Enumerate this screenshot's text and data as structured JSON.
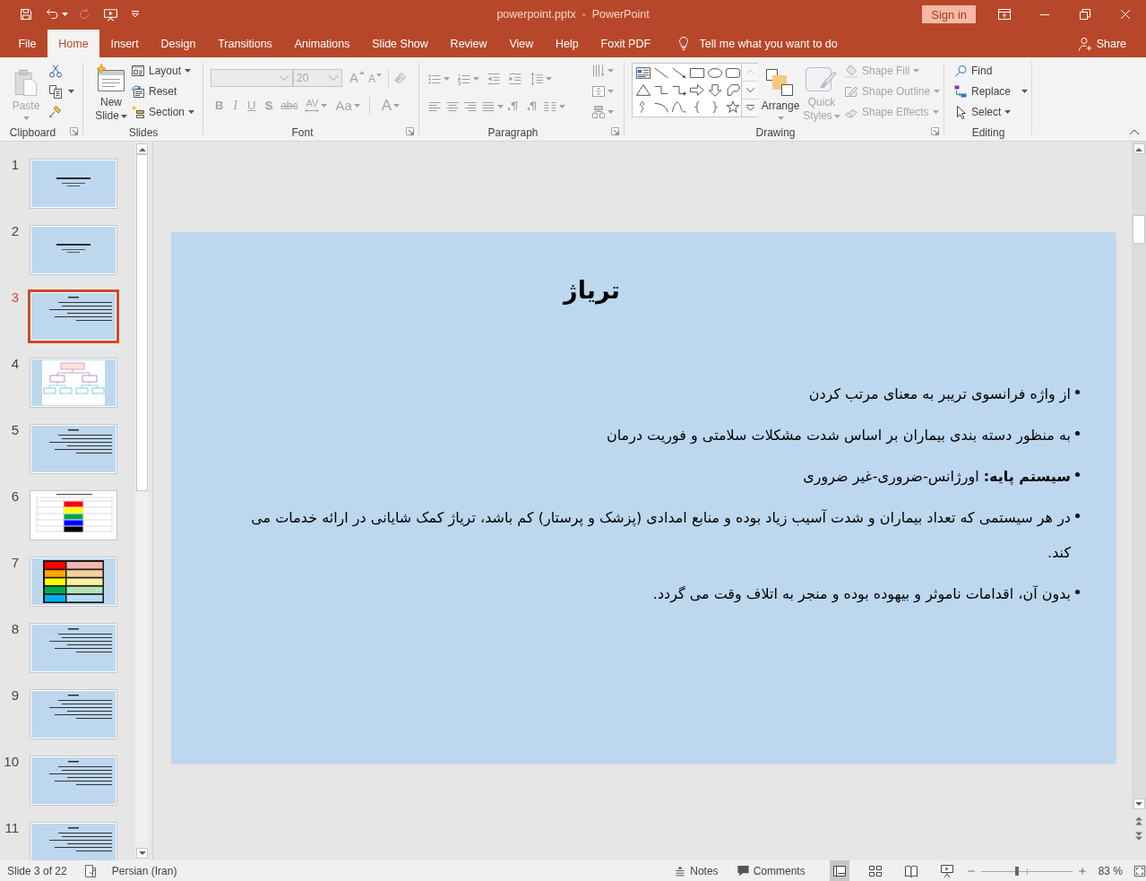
{
  "window": {
    "title": "powerpoint.pptx  -  PowerPoint",
    "sign_in": "Sign in"
  },
  "tabs": [
    {
      "label": "File",
      "selected": false
    },
    {
      "label": "Home",
      "selected": true
    },
    {
      "label": "Insert",
      "selected": false
    },
    {
      "label": "Design",
      "selected": false
    },
    {
      "label": "Transitions",
      "selected": false
    },
    {
      "label": "Animations",
      "selected": false
    },
    {
      "label": "Slide Show",
      "selected": false
    },
    {
      "label": "Review",
      "selected": false
    },
    {
      "label": "View",
      "selected": false
    },
    {
      "label": "Help",
      "selected": false
    },
    {
      "label": "Foxit PDF",
      "selected": false
    }
  ],
  "tell_me": {
    "placeholder": "Tell me what you want to do"
  },
  "share": {
    "label": "Share"
  },
  "ribbon": {
    "clipboard": {
      "label": "Clipboard",
      "paste": {
        "label": "Paste",
        "disabled": true
      }
    },
    "slides": {
      "label": "Slides",
      "new_slide": {
        "label": "New Slide"
      },
      "layout": {
        "label": "Layout"
      },
      "reset": {
        "label": "Reset"
      },
      "section": {
        "label": "Section"
      }
    },
    "font": {
      "label": "Font",
      "size": {
        "value": "20",
        "disabled": true
      },
      "size_buttons": [
        {
          "kind": "grow",
          "label": "A",
          "disabled": true
        },
        {
          "kind": "shrink",
          "label": "A",
          "disabled": true
        }
      ],
      "format_buttons": [
        {
          "kind": "bold",
          "label": "B",
          "disabled": true
        },
        {
          "kind": "italic",
          "label": "I",
          "disabled": true
        },
        {
          "kind": "underline",
          "label": "U",
          "disabled": true
        },
        {
          "kind": "shadow",
          "label": "S",
          "disabled": true
        },
        {
          "kind": "strikethrough",
          "label": "abc",
          "disabled": true
        },
        {
          "kind": "spacing",
          "label": "AV",
          "disabled": true
        },
        {
          "kind": "case",
          "label": "Aa",
          "disabled": true
        },
        {
          "kind": "color",
          "label": "A",
          "disabled": true
        }
      ]
    },
    "paragraph": {
      "label": "Paragraph"
    },
    "drawing": {
      "label": "Drawing",
      "arrange": {
        "label": "Arrange"
      },
      "quick_styles": {
        "label": "Quick Styles",
        "disabled": true
      },
      "shape_fill": {
        "label": "Shape Fill",
        "disabled": true
      },
      "shape_outline": {
        "label": "Shape Outline",
        "disabled": true
      },
      "shape_effects": {
        "label": "Shape Effects",
        "disabled": true
      }
    },
    "editing": {
      "label": "Editing",
      "find": {
        "label": "Find"
      },
      "replace": {
        "label": "Replace"
      },
      "select": {
        "label": "Select"
      }
    }
  },
  "slides": [
    {
      "number": "1",
      "kind": "title",
      "selected": false
    },
    {
      "number": "2",
      "kind": "title",
      "selected": false
    },
    {
      "number": "3",
      "kind": "text",
      "selected": true
    },
    {
      "number": "4",
      "kind": "diagram",
      "selected": false
    },
    {
      "number": "5",
      "kind": "text",
      "selected": false
    },
    {
      "number": "6",
      "kind": "table",
      "selected": false
    },
    {
      "number": "7",
      "kind": "bars",
      "selected": false
    },
    {
      "number": "8",
      "kind": "text",
      "selected": false
    },
    {
      "number": "9",
      "kind": "text",
      "selected": false
    },
    {
      "number": "10",
      "kind": "text",
      "selected": false
    },
    {
      "number": "11",
      "kind": "text",
      "selected": false
    }
  ],
  "slide": {
    "title": "تریاژ",
    "bullets": [
      "از واژه فرانسوی تریبر به معنای مرتب کردن",
      "به منظور دسته بندی بیماران بر اساس شدت مشکلات سلامتی و فوریت درمان",
      "**سیستم پایه:** اورژانس-ضروری-غیر ضروری",
      "در هر سیستمی که تعداد بیماران و شدت آسیب زیاد بوده و منابع امدادی (پزشک و پرستار) کم باشد، تریاژ کمک شایانی در ارائه خدمات می کند.",
      "بدون آن، اقدامات ناموثر و بیهوده بوده و منجر به اتلاف وقت می گردد."
    ]
  },
  "status_bar": {
    "slide_info": "Slide 3 of 22",
    "language": "Persian (Iran)",
    "notes": "Notes",
    "comments": "Comments",
    "views": [
      {
        "kind": "normal",
        "selected": true
      },
      {
        "kind": "sorter",
        "selected": false
      },
      {
        "kind": "reading",
        "selected": false
      },
      {
        "kind": "slideshow",
        "selected": false
      }
    ],
    "zoom": {
      "level": 0.4,
      "reading": "83 %"
    }
  }
}
